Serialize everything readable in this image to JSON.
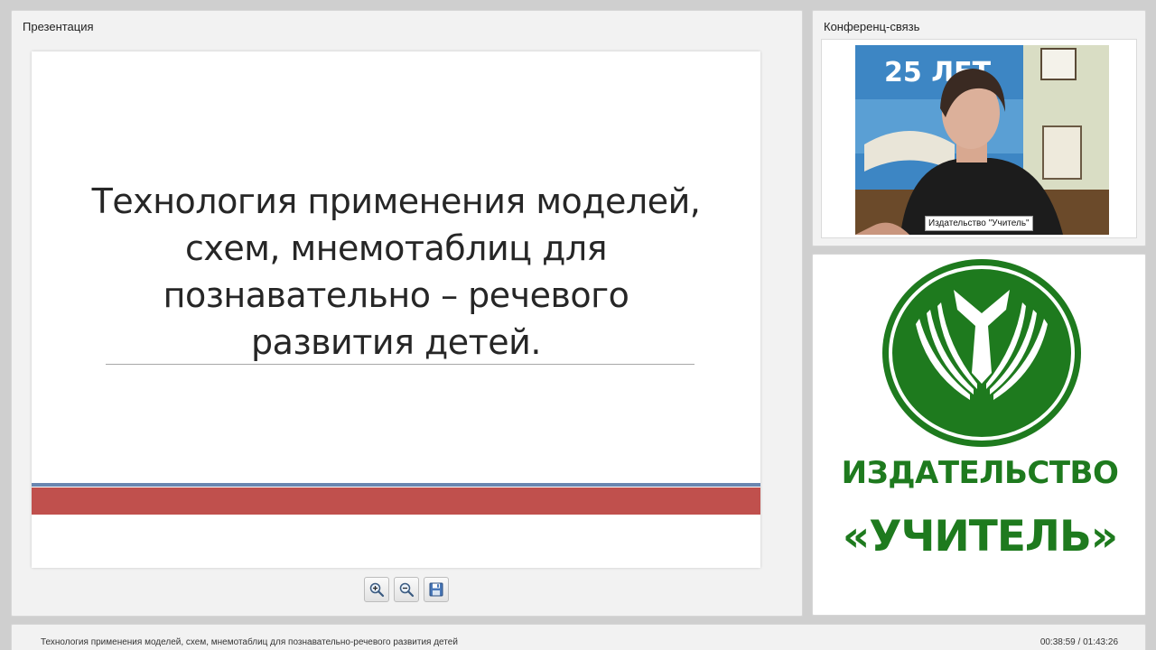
{
  "presentation_panel": {
    "title": "Презентация"
  },
  "slide": {
    "title": "Технология применения моделей, схем, мнемотаблиц для познавательно – речевого развития детей."
  },
  "toolbar": {
    "zoom_in_icon": "zoom-in-icon",
    "zoom_out_icon": "zoom-out-icon",
    "save_icon": "save-icon"
  },
  "conference_panel": {
    "title": "Конференц-связь",
    "video_label": "Издательство \"Учитель\"",
    "banner_text": "25 ЛЕТ"
  },
  "logo": {
    "line1": "ИЗДАТЕЛЬСТВО",
    "line2": "«УЧИТЕЛЬ»",
    "color": "#1e7a1e"
  },
  "bottom_bar": {
    "title": "Технология применения моделей, схем, мнемотаблиц для познавательно-речевого развития детей",
    "time": "00:38:59 / 01:43:26"
  }
}
